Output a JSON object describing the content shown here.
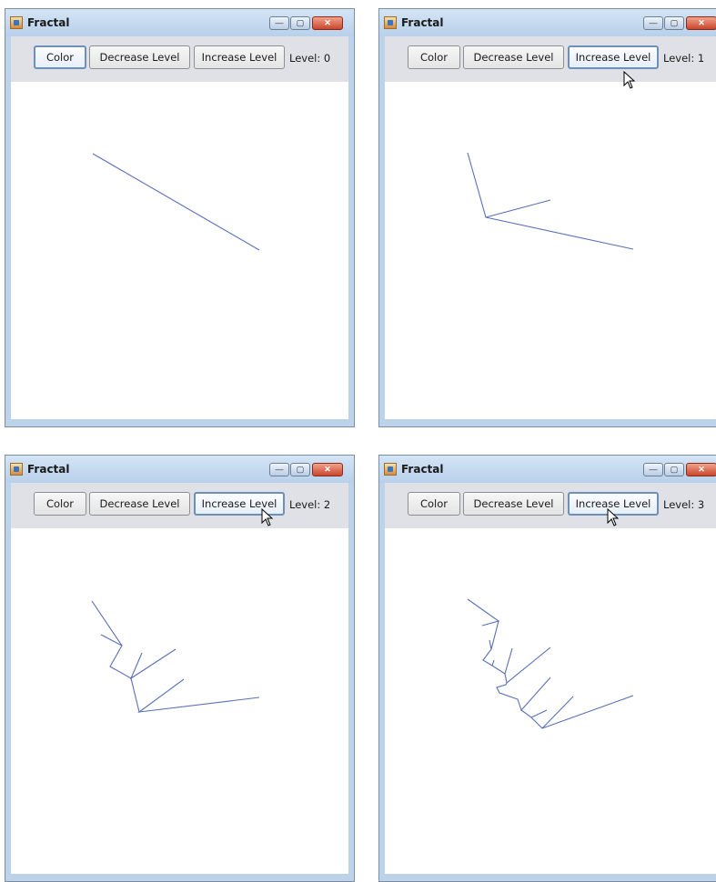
{
  "windows": [
    {
      "title": "Fractal",
      "buttons": {
        "color": "Color",
        "decrease": "Decrease Level",
        "increase": "Increase Level"
      },
      "level_label": "Level: 0",
      "level": 0
    },
    {
      "title": "Fractal",
      "buttons": {
        "color": "Color",
        "decrease": "Decrease Level",
        "increase": "Increase Level"
      },
      "level_label": "Level: 1",
      "level": 1
    },
    {
      "title": "Fractal",
      "buttons": {
        "color": "Color",
        "decrease": "Decrease Level",
        "increase": "Increase Level"
      },
      "level_label": "Level: 2",
      "level": 2
    },
    {
      "title": "Fractal",
      "buttons": {
        "color": "Color",
        "decrease": "Decrease Level",
        "increase": "Increase Level"
      },
      "level_label": "Level: 3",
      "level": 3
    }
  ],
  "colors": {
    "fractal_line": "#5a6fb8",
    "canvas": "#ffffff",
    "window_frame": "#bcd3ea",
    "toolbar": "#dfe1e6"
  },
  "icons": {
    "app": "java-coffee-icon",
    "minimize": "minimize-icon",
    "maximize": "maximize-icon",
    "close": "close-icon",
    "cursor": "mouse-pointer-icon"
  }
}
